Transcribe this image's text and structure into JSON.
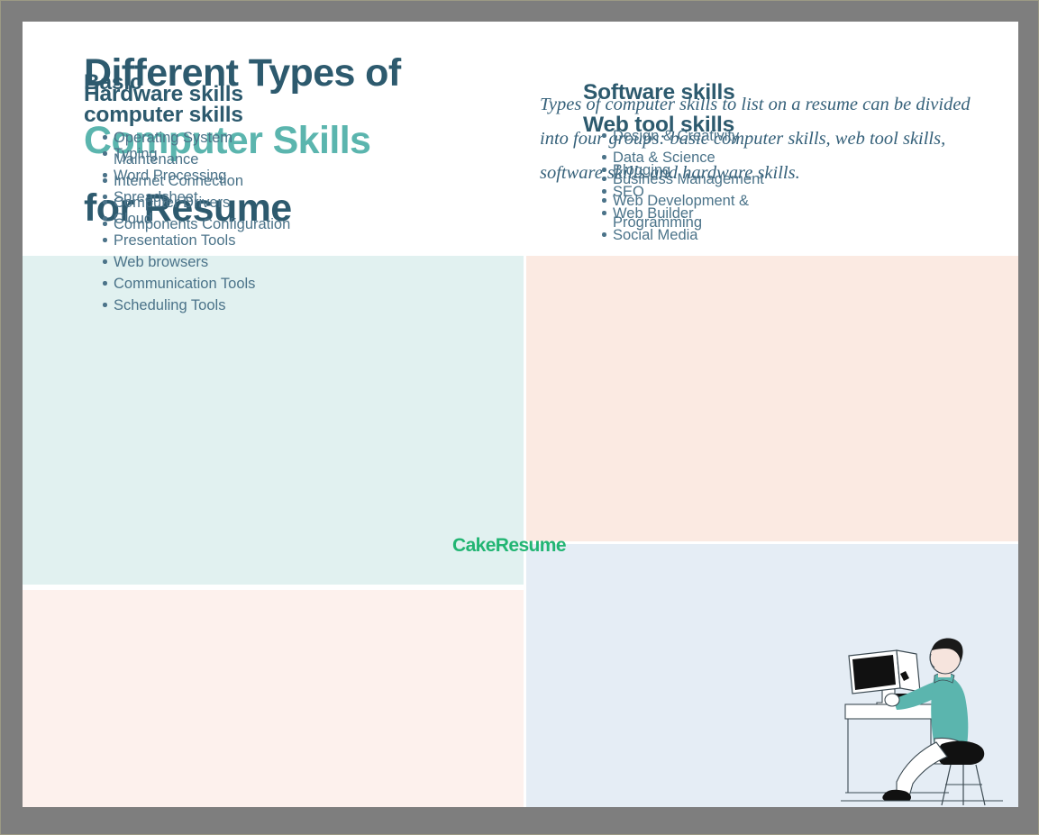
{
  "header": {
    "title_lines": [
      {
        "text": "Different Types of",
        "accent": false
      },
      {
        "text": "Computer Skills",
        "accent": true
      },
      {
        "text": "for Resume",
        "accent": false
      }
    ],
    "lede": "Types of computer skills to list on a resume can be divided into four groups: basic computer skills, web tool skills, software skills and hardware skills."
  },
  "panels": {
    "basic": {
      "heading_line1": "Basic",
      "heading_line2": "computer skills",
      "items": [
        "Typing",
        "Word Processing",
        "Spreadsheet",
        "Cloud",
        "Presentation Tools",
        "Web browsers",
        "Communication Tools",
        "Scheduling Tools"
      ],
      "background": "#e1f1f0"
    },
    "web": {
      "heading": "Web tool skills",
      "items": [
        "Blogging",
        "SEO",
        "Web Builder",
        "Social Media"
      ],
      "background": "#fbeae2"
    },
    "hardware": {
      "heading": "Hardware skills",
      "items": [
        "Operating System Maintenance",
        "Internet Connection",
        "Computer Drivers",
        "Components Configuration"
      ],
      "background": "#fdf1ed"
    },
    "software": {
      "heading": "Software skills",
      "items": [
        "Design & Creativity",
        "Data & Science",
        "Business Management",
        "Web Development & Programming"
      ],
      "background": "#e5edf5"
    }
  },
  "brand": {
    "wordmark": "CakeResume",
    "color": "#22b573"
  },
  "illustration": {
    "name": "person-at-desk-using-computer",
    "shirt_color": "#5bb5ae",
    "hair_color": "#1a1a1a",
    "screen_color": "#111111"
  },
  "colors": {
    "title_dark": "#2d5a6e",
    "title_accent": "#5bb5ae",
    "body_text": "#4b7389",
    "lede_text": "#36617a",
    "frame": "#7e7e7e"
  }
}
